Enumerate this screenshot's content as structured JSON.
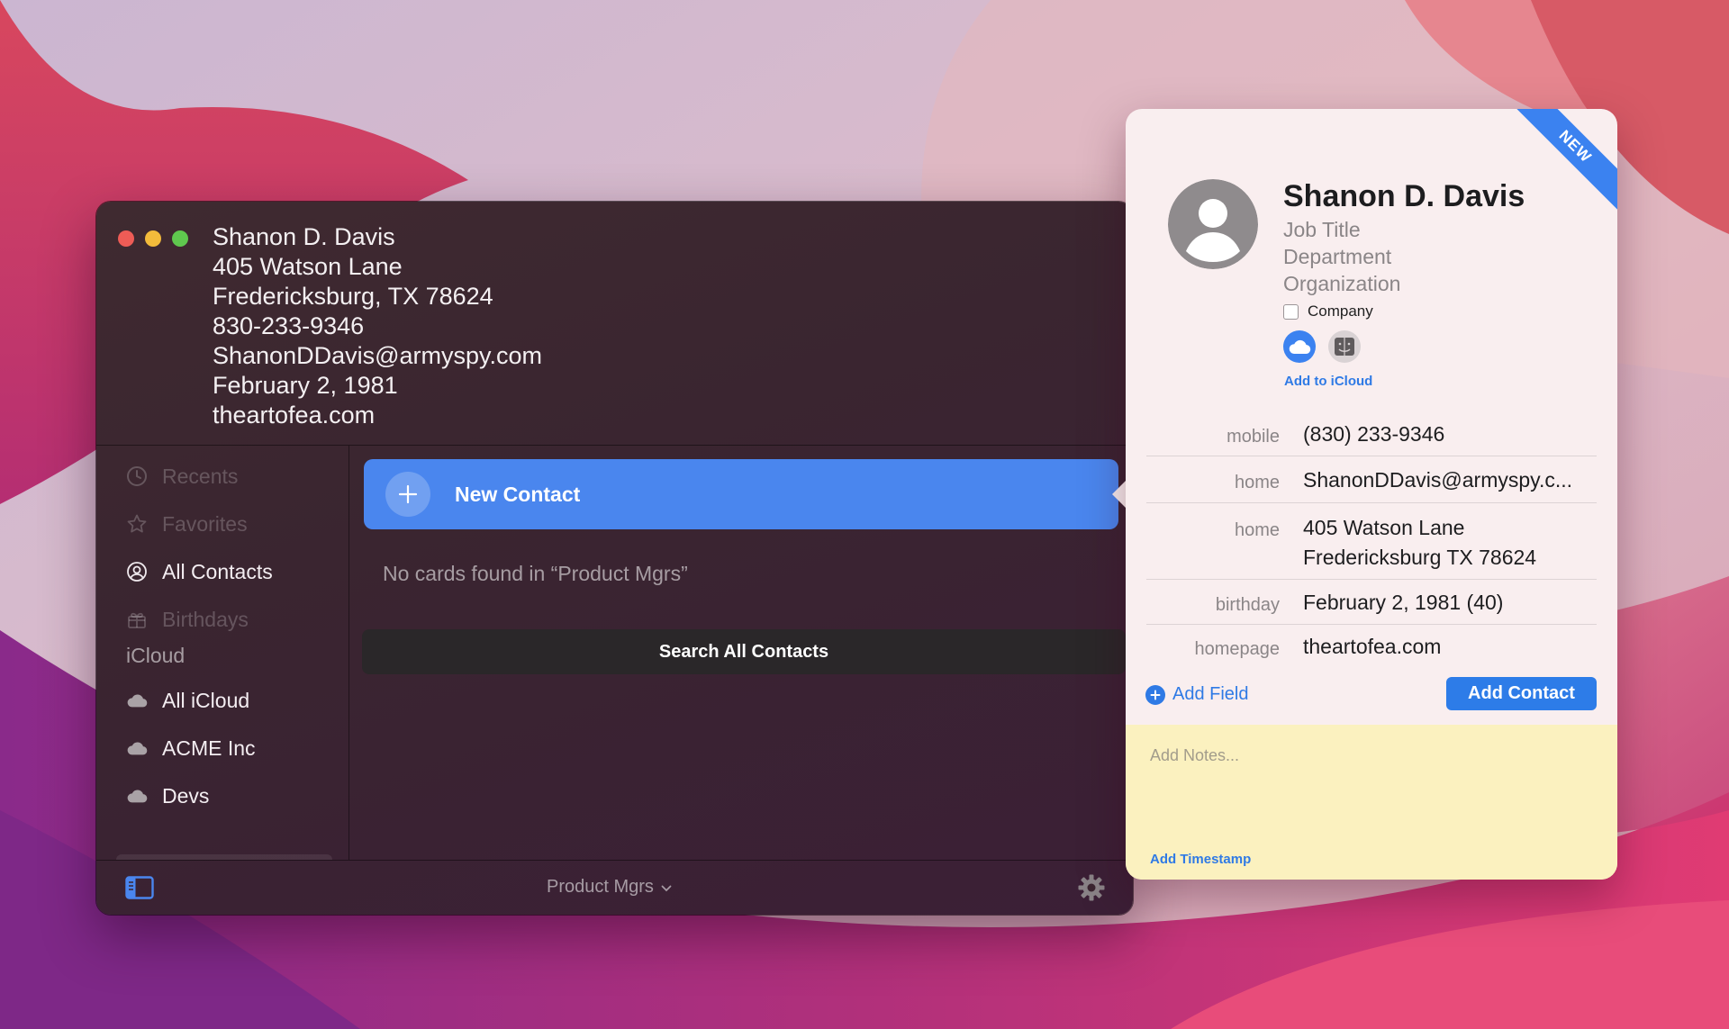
{
  "main_window": {
    "header_card": {
      "name": "Shanon D. Davis",
      "address_line1": "405 Watson Lane",
      "address_line2": "Fredericksburg, TX 78624",
      "phone": "830-233-9346",
      "email": "ShanonDDavis@armyspy.com",
      "birthday": "February 2, 1981",
      "website": "theartofea.com"
    },
    "sidebar": {
      "items": [
        {
          "label": "Recents",
          "icon": "clock-icon",
          "enabled": false
        },
        {
          "label": "Favorites",
          "icon": "star-icon",
          "enabled": false
        },
        {
          "label": "All Contacts",
          "icon": "person-circle-icon",
          "enabled": true
        },
        {
          "label": "Birthdays",
          "icon": "gift-icon",
          "enabled": false
        }
      ],
      "section_title": "iCloud",
      "groups": [
        {
          "label": "All iCloud",
          "icon": "cloud-icon"
        },
        {
          "label": "ACME Inc",
          "icon": "cloud-icon"
        },
        {
          "label": "Devs",
          "icon": "cloud-icon"
        }
      ]
    },
    "content": {
      "new_contact_label": "New Contact",
      "empty_message": "No cards found in “Product Mgrs”",
      "search_all_label": "Search All Contacts"
    },
    "bottom_bar": {
      "group_select": "Product Mgrs"
    }
  },
  "popover": {
    "ribbon": "NEW",
    "name": "Shanon D. Davis",
    "job_title_placeholder": "Job Title",
    "department_placeholder": "Department",
    "organization_placeholder": "Organization",
    "company_label": "Company",
    "company_checked": false,
    "add_to_icloud": "Add to iCloud",
    "fields": [
      {
        "label": "mobile",
        "value": "(830) 233-9346"
      },
      {
        "label": "home",
        "value": "ShanonDDavis@armyspy.c..."
      },
      {
        "label": "home",
        "value_line1": "405 Watson Lane",
        "value_line2": "Fredericksburg  TX  78624"
      },
      {
        "label": "birthday",
        "value": "February 2, 1981 (40)"
      },
      {
        "label": "homepage",
        "value": "theartofea.com"
      }
    ],
    "add_field_label": "Add Field",
    "add_contact_label": "Add Contact",
    "notes_placeholder": "Add Notes...",
    "add_timestamp_label": "Add Timestamp"
  },
  "colors": {
    "accent_blue": "#4a86ee",
    "link_blue": "#2f7ae5",
    "notes_yellow": "#fbf1bf",
    "ribbon_blue": "#3b82f0"
  }
}
